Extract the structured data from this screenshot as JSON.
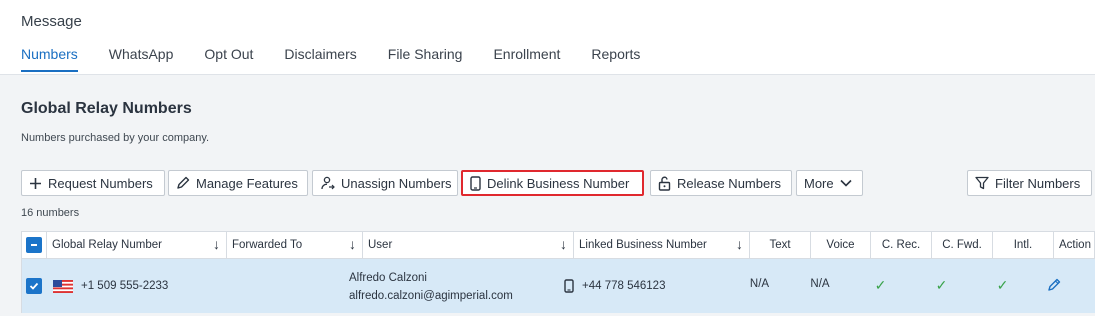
{
  "app": {
    "title": "Message"
  },
  "tabs": [
    {
      "label": "Numbers",
      "active": true
    },
    {
      "label": "WhatsApp"
    },
    {
      "label": "Opt Out"
    },
    {
      "label": "Disclaimers"
    },
    {
      "label": "File Sharing"
    },
    {
      "label": "Enrollment"
    },
    {
      "label": "Reports"
    }
  ],
  "section": {
    "title": "Global Relay Numbers",
    "subtitle": "Numbers purchased by your company."
  },
  "toolbar": {
    "request": "Request Numbers",
    "manage": "Manage Features",
    "unassign": "Unassign Numbers",
    "delink": "Delink Business Number",
    "release": "Release Numbers",
    "more": "More",
    "filter": "Filter Numbers"
  },
  "count_text": "16 numbers",
  "table": {
    "headers": {
      "number": "Global Relay Number",
      "forwarded": "Forwarded To",
      "user": "User",
      "linked": "Linked Business Number",
      "text": "Text",
      "voice": "Voice",
      "crec": "C. Rec.",
      "cfwd": "C. Fwd.",
      "intl": "Intl.",
      "action": "Action"
    },
    "rows": [
      {
        "number": "+1 509 555-2233",
        "forwarded": "",
        "user_name": "Alfredo Calzoni",
        "user_email": "alfredo.calzoni@agimperial.com",
        "linked": "+44 778 546123",
        "text": "N/A",
        "voice": "N/A",
        "crec": "✓",
        "cfwd": "✓",
        "intl": "✓"
      }
    ]
  },
  "colors": {
    "accent": "#1a6fc2",
    "highlight": "#e0282e",
    "selected_row": "#d7e9f7",
    "check": "#3aa34b"
  },
  "icons": {
    "request": "plus-icon",
    "manage": "pencil-icon",
    "unassign": "unassign-user-icon",
    "delink": "phone-icon",
    "release": "unlock-icon",
    "more": "chevron-down-icon",
    "filter": "filter-icon",
    "flag": "us-flag-icon",
    "action": "edit-icon"
  }
}
